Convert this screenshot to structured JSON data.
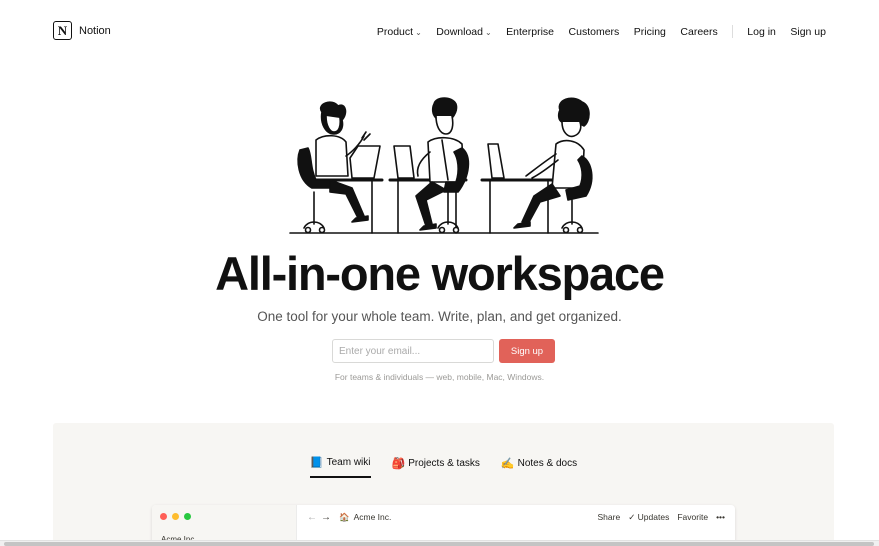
{
  "nav": {
    "logo_text": "Notion",
    "logo_letter": "N",
    "links": [
      {
        "label": "Product",
        "has_dropdown": true
      },
      {
        "label": "Download",
        "has_dropdown": true
      },
      {
        "label": "Enterprise",
        "has_dropdown": false
      },
      {
        "label": "Customers",
        "has_dropdown": false
      },
      {
        "label": "Pricing",
        "has_dropdown": false
      },
      {
        "label": "Careers",
        "has_dropdown": false
      }
    ],
    "login": "Log in",
    "signup": "Sign up"
  },
  "hero": {
    "title": "All-in-one workspace",
    "subtitle": "One tool for your whole team. Write, plan, and get organized.",
    "email_placeholder": "Enter your email...",
    "signup_button": "Sign up",
    "fineprint": "For teams & individuals — web, mobile, Mac, Windows."
  },
  "demo": {
    "tabs": [
      {
        "icon": "📘",
        "label": "Team wiki",
        "active": true
      },
      {
        "icon": "🎒",
        "label": "Projects & tasks",
        "active": false
      },
      {
        "icon": "✍️",
        "label": "Notes & docs",
        "active": false
      }
    ],
    "window": {
      "breadcrumb_icon": "🏠",
      "breadcrumb": "Acme Inc.",
      "sidebar_workspace": "Acme Inc.",
      "actions": {
        "share": "Share",
        "updates": "✓ Updates",
        "favorite": "Favorite",
        "more": "•••"
      }
    }
  },
  "colors": {
    "accent": "#e16259",
    "text": "#37352f",
    "panel_bg": "#f7f6f3",
    "traffic_red": "#ff5f57",
    "traffic_yellow": "#febc2e",
    "traffic_green": "#28c840"
  }
}
